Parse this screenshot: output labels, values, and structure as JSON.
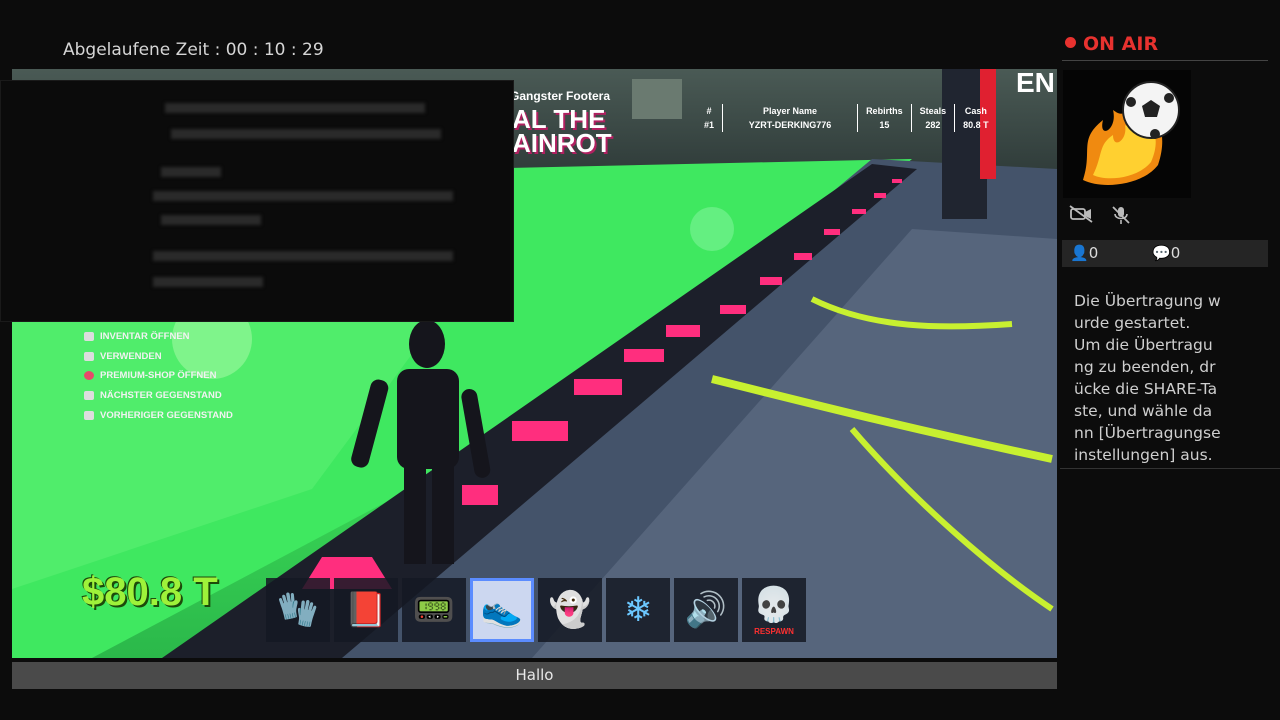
{
  "header": {
    "elapsed_label": "Abgelaufene Zeit :",
    "elapsed_value": "00 : 10 : 29"
  },
  "broadcast": {
    "status": "ON AIR",
    "status_color": "#e8322f",
    "viewers": "0",
    "comments": "0",
    "info": "Die Übertragung w\nurde gestartet.\nUm die Übertragu\nng zu beenden, dr\nücke die SHARE-Ta\nste, und wähle da\nnn [Übertragungse\ninstellungen] aus.",
    "camera_status_icon": "camera-off-icon",
    "mic_status_icon": "mic-off-icon"
  },
  "chat": {
    "message": "Hallo"
  },
  "game": {
    "title_top": "Gangster Footera",
    "logo": "AL THE\nAINROT",
    "corner": "EN",
    "money": "$80.8 T",
    "money_color": "#9ef23a",
    "controls": [
      {
        "label": "INVENTAR ÖFFNEN",
        "icon": "touchpad-icon"
      },
      {
        "label": "VERWENDEN",
        "icon": "r2-icon"
      },
      {
        "label": "PREMIUM-SHOP ÖFFNEN",
        "icon": "circle-button-icon"
      },
      {
        "label": "NÄCHSTER GEGENSTAND",
        "icon": "r1-icon"
      },
      {
        "label": "VORHERIGER GEGENSTAND",
        "icon": "l1-icon"
      }
    ],
    "hotbar": [
      {
        "icon": "glove-icon",
        "glyph": "🧤"
      },
      {
        "icon": "spellbook-icon",
        "glyph": "📕"
      },
      {
        "icon": "remote-icon",
        "glyph": "📟"
      },
      {
        "icon": "speed-shoe-icon",
        "glyph": "👟",
        "active": true
      },
      {
        "icon": "ghost-icon",
        "glyph": "👻"
      },
      {
        "icon": "snowflake-icon",
        "glyph": "❄"
      },
      {
        "icon": "sound-book-icon",
        "glyph": "🔊"
      },
      {
        "icon": "skull-respawn-icon",
        "glyph": "💀",
        "caption": "RESPAWN"
      }
    ],
    "leaderboard": {
      "headers": [
        "#",
        "Player Name",
        "Rebirths",
        "Steals",
        "Cash"
      ],
      "rows": [
        [
          "#1",
          "YZRT-DERKING776",
          "15",
          "282",
          "80.8 T"
        ]
      ]
    }
  }
}
